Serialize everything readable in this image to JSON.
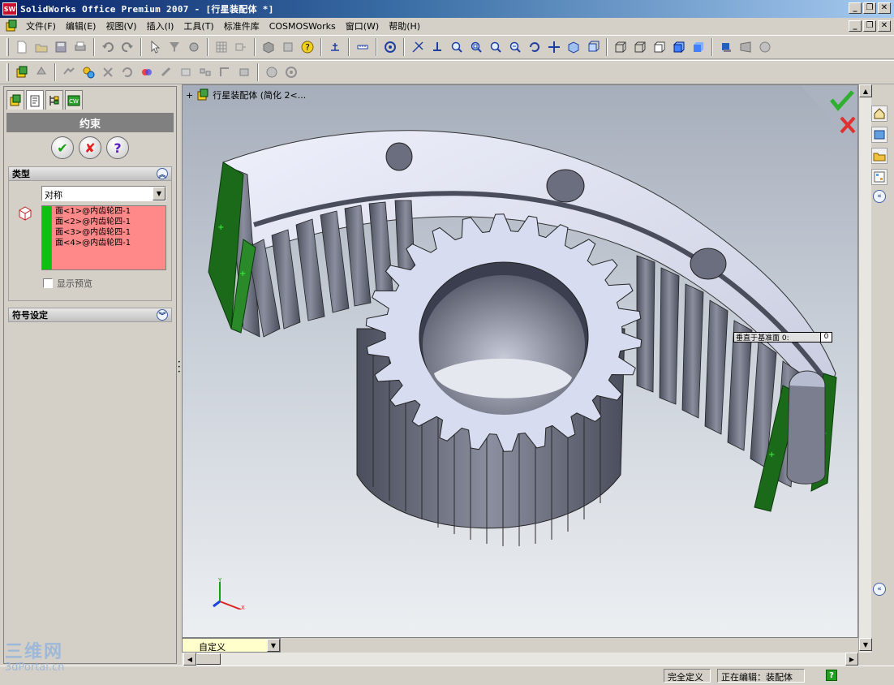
{
  "window": {
    "title": "SolidWorks Office Premium 2007 - [行星装配体 *]",
    "logo_text": "SW"
  },
  "menu": {
    "items": [
      "文件(F)",
      "编辑(E)",
      "视图(V)",
      "插入(I)",
      "工具(T)",
      "标准件库",
      "COSMOSWorks",
      "窗口(W)",
      "帮助(H)"
    ]
  },
  "property_manager": {
    "title": "约束",
    "ok_label": "✔",
    "cancel_label": "✘",
    "help_label": "?",
    "type_section": {
      "title": "类型",
      "selected_type": "对称",
      "selections": [
        "面<1>@内齿轮四-1",
        "面<2>@内齿轮四-1",
        "面<3>@内齿轮四-1",
        "面<4>@内齿轮四-1"
      ],
      "show_preview_label": "显示预览",
      "show_preview_checked": false
    },
    "symbol_section": {
      "title": "符号设定"
    }
  },
  "viewport": {
    "breadcrumb_expand": "+",
    "breadcrumb": "行星装配体  (简化  2<...",
    "dimension_label": "垂直于基准面 0:",
    "dimension_value": "0",
    "triad_x": "X",
    "triad_y": "Y",
    "view_orientation": "自定义"
  },
  "status_bar": {
    "definition": "完全定义",
    "editing": "正在编辑：装配体",
    "help_label": "?"
  },
  "watermark": {
    "logo": "三维网",
    "site": "3dPortal.cn"
  },
  "colors": {
    "selection_list_bg": "#ff8888",
    "selection_bar": "#10c010",
    "title_bar": "#0a246a",
    "gear_face": "#d8dcf0",
    "gear_teeth": "#6a6e7e",
    "highlight_face": "#1a6a1a"
  }
}
